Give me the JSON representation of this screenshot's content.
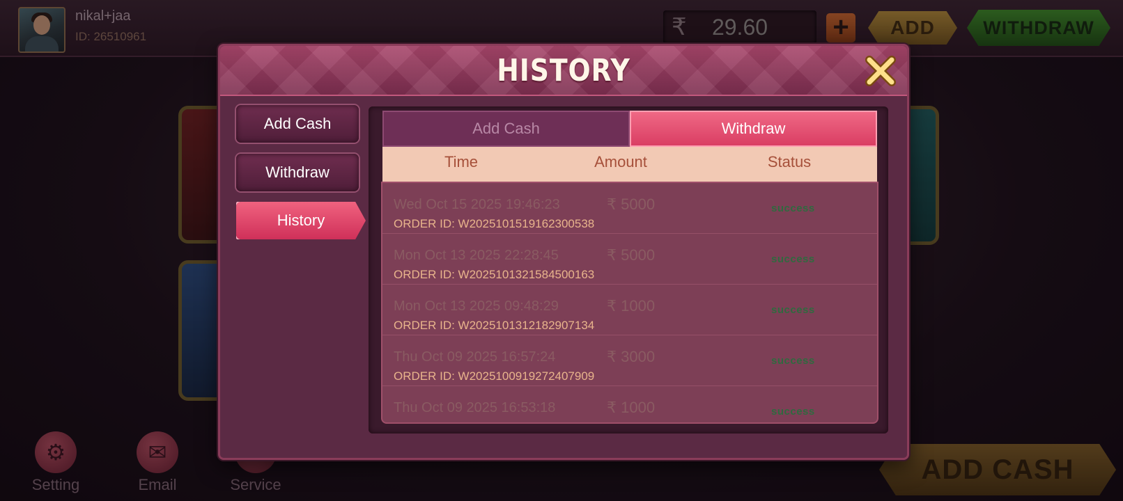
{
  "user": {
    "name": "nikal+jaa",
    "id": "ID: 26510961"
  },
  "wallet": {
    "currency_symbol": "₹",
    "balance": "29.60",
    "plus_label": "+",
    "add_label": "ADD",
    "withdraw_label": "WITHDRAW"
  },
  "bottom_nav": [
    {
      "label": "Setting",
      "icon": "gear-icon"
    },
    {
      "label": "Email",
      "icon": "mail-icon"
    },
    {
      "label": "Service",
      "icon": "headset-icon"
    }
  ],
  "add_cash_big_label": "ADD CASH",
  "modal": {
    "title": "HISTORY",
    "side_tabs": [
      "Add Cash",
      "Withdraw",
      "History"
    ],
    "active_side_tab": "History",
    "sub_tabs": [
      "Add Cash",
      "Withdraw"
    ],
    "active_sub_tab": "Withdraw",
    "columns": [
      "Time",
      "Amount",
      "Status"
    ],
    "rows": [
      {
        "time": "Wed Oct 15 2025  19:46:23",
        "amount": "₹ 5000",
        "status": "success",
        "order": "ORDER ID: W2025101519162300538"
      },
      {
        "time": "Mon Oct 13 2025  22:28:45",
        "amount": "₹ 5000",
        "status": "success",
        "order": "ORDER ID: W2025101321584500163"
      },
      {
        "time": "Mon Oct 13 2025  09:48:29",
        "amount": "₹ 1000",
        "status": "success",
        "order": "ORDER ID: W2025101312182907134"
      },
      {
        "time": "Thu Oct 09 2025  16:57:24",
        "amount": "₹ 3000",
        "status": "success",
        "order": "ORDER ID: W2025100919272407909"
      },
      {
        "time": "Thu Oct 09 2025  16:53:18",
        "amount": "₹ 1000",
        "status": "success",
        "order": ""
      }
    ]
  },
  "colors": {
    "accent_pink": "#d93c62",
    "panel": "#5b2a44",
    "success_green": "#2f6a3f"
  }
}
